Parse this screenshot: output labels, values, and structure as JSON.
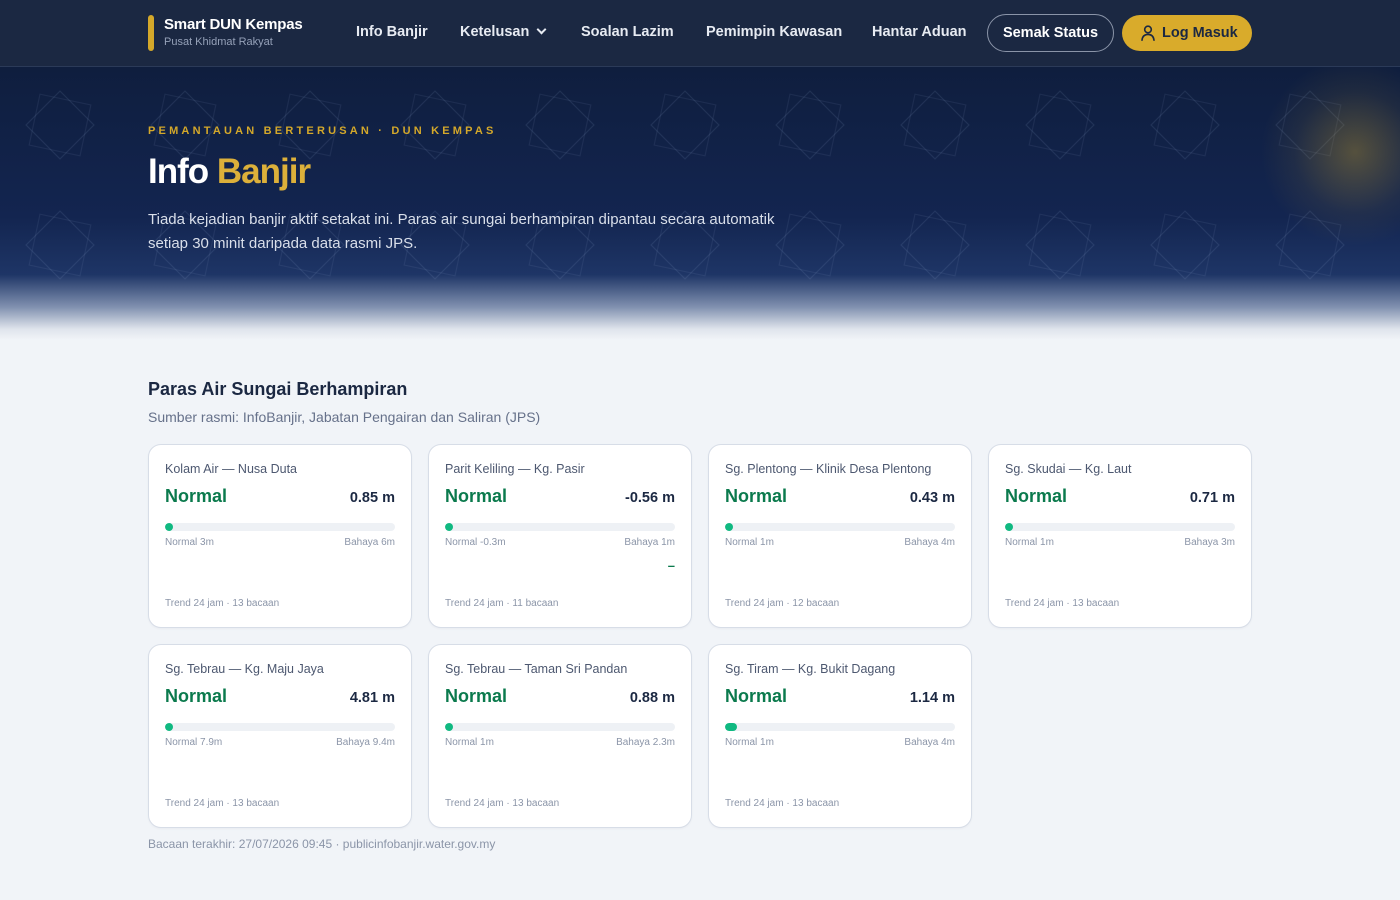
{
  "brand": {
    "title": "Smart DUN Kempas",
    "subtitle": "Pusat Khidmat Rakyat"
  },
  "nav": {
    "items": [
      {
        "label": "Info Banjir"
      },
      {
        "label": "Ketelusan"
      },
      {
        "label": "Soalan Lazim"
      },
      {
        "label": "Pemimpin Kawasan"
      },
      {
        "label": "Hantar Aduan"
      }
    ],
    "status_button": "Semak Status",
    "login_button": "Log Masuk"
  },
  "hero": {
    "eyebrow": "PEMANTAUAN BERTERUSAN · DUN KEMPAS",
    "title_part1": "Info",
    "title_part2": "Banjir",
    "description": "Tiada kejadian banjir aktif setakat ini. Paras air sungai berhampiran dipantau secara automatik setiap 30 minit daripada data rasmi JPS."
  },
  "section": {
    "title": "Paras Air Sungai Berhampiran",
    "subtitle": "Sumber rasmi: InfoBanjir, Jabatan Pengairan dan Saliran (JPS)"
  },
  "stations": [
    {
      "name": "Kolam Air — Nusa Duta",
      "status": "Normal",
      "level": "0.85 m",
      "fill_fraction": 0.0,
      "normal": "Normal 3m",
      "danger": "Bahaya 6m",
      "trend": "Trend 24 jam · 13 bacaan",
      "extra": ""
    },
    {
      "name": "Parit Keliling — Kg. Pasir",
      "status": "Normal",
      "level": "-0.56 m",
      "fill_fraction": 0.0,
      "normal": "Normal -0.3m",
      "danger": "Bahaya 1m",
      "trend": "Trend 24 jam · 11 bacaan",
      "extra": "–"
    },
    {
      "name": "Sg. Plentong — Klinik Desa Plentong",
      "status": "Normal",
      "level": "0.43 m",
      "fill_fraction": 0.0,
      "normal": "Normal 1m",
      "danger": "Bahaya 4m",
      "trend": "Trend 24 jam · 12 bacaan",
      "extra": ""
    },
    {
      "name": "Sg. Skudai — Kg. Laut",
      "status": "Normal",
      "level": "0.71 m",
      "fill_fraction": 0.0,
      "normal": "Normal 1m",
      "danger": "Bahaya 3m",
      "trend": "Trend 24 jam · 13 bacaan",
      "extra": ""
    },
    {
      "name": "Sg. Tebrau — Kg. Maju Jaya",
      "status": "Normal",
      "level": "4.81 m",
      "fill_fraction": 0.0,
      "normal": "Normal 7.9m",
      "danger": "Bahaya 9.4m",
      "trend": "Trend 24 jam · 13 bacaan",
      "extra": ""
    },
    {
      "name": "Sg. Tebrau — Taman Sri Pandan",
      "status": "Normal",
      "level": "0.88 m",
      "fill_fraction": 0.0,
      "normal": "Normal 1m",
      "danger": "Bahaya 2.3m",
      "trend": "Trend 24 jam · 13 bacaan",
      "extra": ""
    },
    {
      "name": "Sg. Tiram — Kg. Bukit Dagang",
      "status": "Normal",
      "level": "1.14 m",
      "fill_fraction": 0.05,
      "normal": "Normal 1m",
      "danger": "Bahaya 4m",
      "trend": "Trend 24 jam · 13 bacaan",
      "extra": ""
    }
  ],
  "footnote": "Bacaan terakhir: 27/07/2026 09:45 · publicinfobanjir.water.gov.my",
  "colors": {
    "navy": "#1b2842",
    "gold": "#d9ab2b",
    "status_normal": "#0b7a4d",
    "bar_fill": "#10b981"
  },
  "icons": {
    "login": "user-icon",
    "dropdown": "chevron-down-icon"
  }
}
